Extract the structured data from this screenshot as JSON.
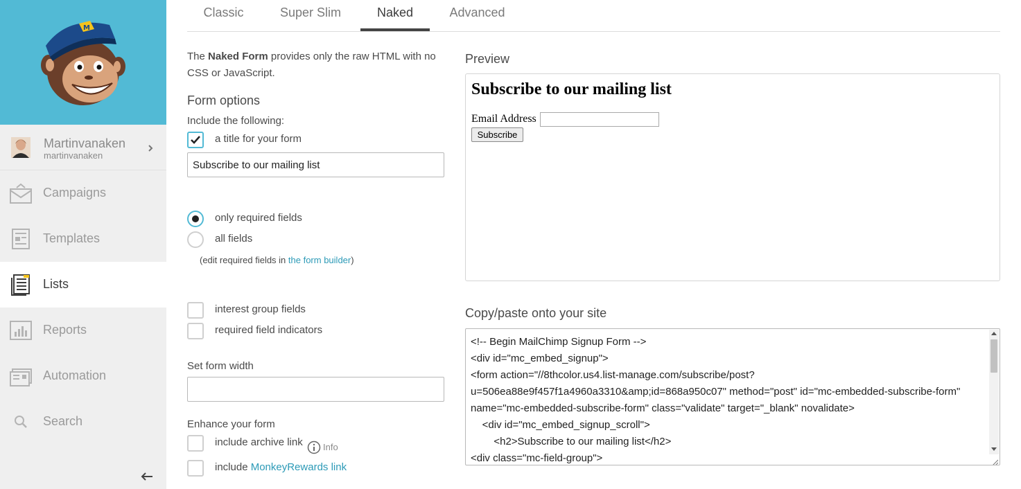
{
  "sidebar": {
    "user": {
      "name": "Martinvanaken",
      "username": "martinvanaken"
    },
    "items": [
      {
        "label": "Campaigns",
        "icon": "campaigns-icon",
        "active": false
      },
      {
        "label": "Templates",
        "icon": "templates-icon",
        "active": false
      },
      {
        "label": "Lists",
        "icon": "lists-icon",
        "active": true
      },
      {
        "label": "Reports",
        "icon": "reports-icon",
        "active": false
      },
      {
        "label": "Automation",
        "icon": "automation-icon",
        "active": false
      },
      {
        "label": "Search",
        "icon": "search-icon",
        "active": false
      }
    ]
  },
  "tabs": [
    {
      "label": "Classic",
      "active": false
    },
    {
      "label": "Super Slim",
      "active": false
    },
    {
      "label": "Naked",
      "active": true
    },
    {
      "label": "Advanced",
      "active": false
    }
  ],
  "form": {
    "intro_prefix": "The ",
    "intro_bold": "Naked Form",
    "intro_suffix": " provides only the raw HTML with no CSS or JavaScript.",
    "options_heading": "Form options",
    "include_label": "Include the following:",
    "title_checkbox": {
      "label": "a title for your form",
      "checked": true
    },
    "title_value": "Subscribe to our mailing list",
    "radio_required": {
      "label": "only required fields",
      "checked": true
    },
    "radio_all": {
      "label": "all fields",
      "checked": false
    },
    "note_prefix": "(edit required fields in ",
    "note_link": "the form builder",
    "note_suffix": ")",
    "interest_groups": {
      "label": "interest group fields",
      "checked": false
    },
    "required_indicators": {
      "label": "required field indicators",
      "checked": false
    },
    "width_label": "Set form width",
    "width_value": "",
    "enhance_heading": "Enhance your form",
    "archive": {
      "label": "include archive link",
      "checked": false
    },
    "info_label": "Info",
    "monkey_prefix": "include ",
    "monkey_link": "MonkeyRewards link"
  },
  "preview": {
    "heading": "Preview",
    "form_title": "Subscribe to our mailing list",
    "email_label": "Email Address",
    "subscribe_button": "Subscribe"
  },
  "code": {
    "heading": "Copy/paste onto your site",
    "lines": [
      "<!-- Begin MailChimp Signup Form -->",
      "<div id=\"mc_embed_signup\">",
      "<form action=\"//8thcolor.us4.list-manage.com/subscribe/post?",
      "u=506ea88e9f457f1a4960a3310&amp;id=868a950c07\" method=\"post\" id=\"mc-embedded-subscribe-form\"",
      "name=\"mc-embedded-subscribe-form\" class=\"validate\" target=\"_blank\" novalidate>",
      "    <div id=\"mc_embed_signup_scroll\">",
      "        <h2>Subscribe to our mailing list</h2>",
      "<div class=\"mc-field-group\">"
    ]
  },
  "colors": {
    "brand": "#52bad5",
    "link": "#2c9ab7",
    "sidebar_bg": "#efefef"
  }
}
